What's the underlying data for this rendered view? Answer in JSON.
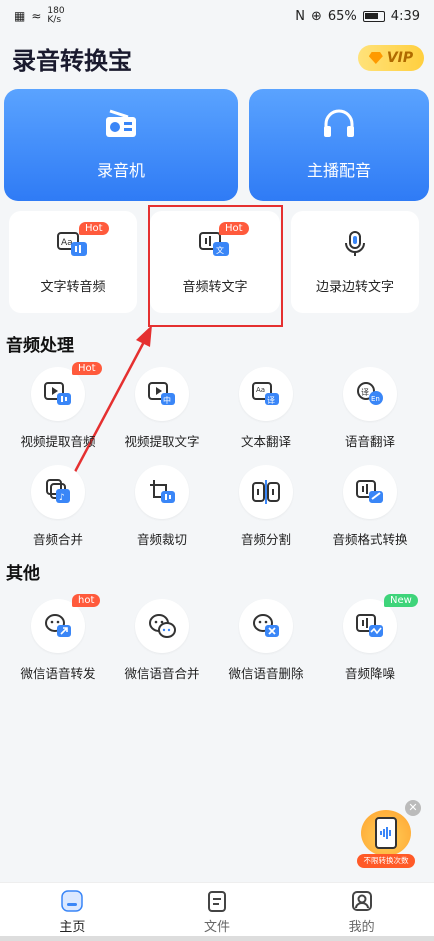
{
  "status_bar": {
    "speed_value": "180",
    "speed_unit": "K/s",
    "battery": "65%",
    "time": "4:39"
  },
  "header": {
    "title": "录音转换宝",
    "vip_label": "VIP"
  },
  "big_cards": [
    {
      "label": "录音机",
      "icon": "radio-icon"
    },
    {
      "label": "主播配音",
      "icon": "headphones-icon"
    }
  ],
  "features": [
    {
      "label": "文字转音频",
      "badge": "Hot",
      "icon": "text-to-audio-icon"
    },
    {
      "label": "音频转文字",
      "badge": "Hot",
      "icon": "audio-to-text-icon"
    },
    {
      "label": "边录边转文字",
      "icon": "microphone-icon"
    }
  ],
  "sections": {
    "audio_processing": "音频处理",
    "other": "其他"
  },
  "audio_tools": [
    {
      "label": "视频提取音频",
      "badge": "Hot",
      "icon": "video-audio-icon"
    },
    {
      "label": "视频提取文字",
      "icon": "video-text-icon"
    },
    {
      "label": "文本翻译",
      "icon": "text-translate-icon"
    },
    {
      "label": "语音翻译",
      "icon": "voice-translate-icon"
    },
    {
      "label": "音频合并",
      "icon": "audio-merge-icon"
    },
    {
      "label": "音频裁切",
      "icon": "audio-crop-icon"
    },
    {
      "label": "音频分割",
      "icon": "audio-split-icon"
    },
    {
      "label": "音频格式转换",
      "icon": "audio-format-icon"
    }
  ],
  "other_tools": [
    {
      "label": "微信语音转发",
      "badge": "hot",
      "icon": "wechat-forward-icon"
    },
    {
      "label": "微信语音合并",
      "icon": "wechat-merge-icon"
    },
    {
      "label": "微信语音删除",
      "icon": "wechat-delete-icon"
    },
    {
      "label": "音频降噪",
      "badge": "New",
      "icon": "audio-denoise-icon"
    }
  ],
  "float_widget": {
    "label": "不限转换次数"
  },
  "bottom_nav": [
    {
      "label": "主页",
      "icon": "home-icon"
    },
    {
      "label": "文件",
      "icon": "file-icon"
    },
    {
      "label": "我的",
      "icon": "profile-icon"
    }
  ],
  "colors": {
    "accent_blue": "#2f7bf5",
    "hot_badge": "#ff5a3c",
    "new_badge": "#3ed47a",
    "highlight_red": "#e53030"
  }
}
